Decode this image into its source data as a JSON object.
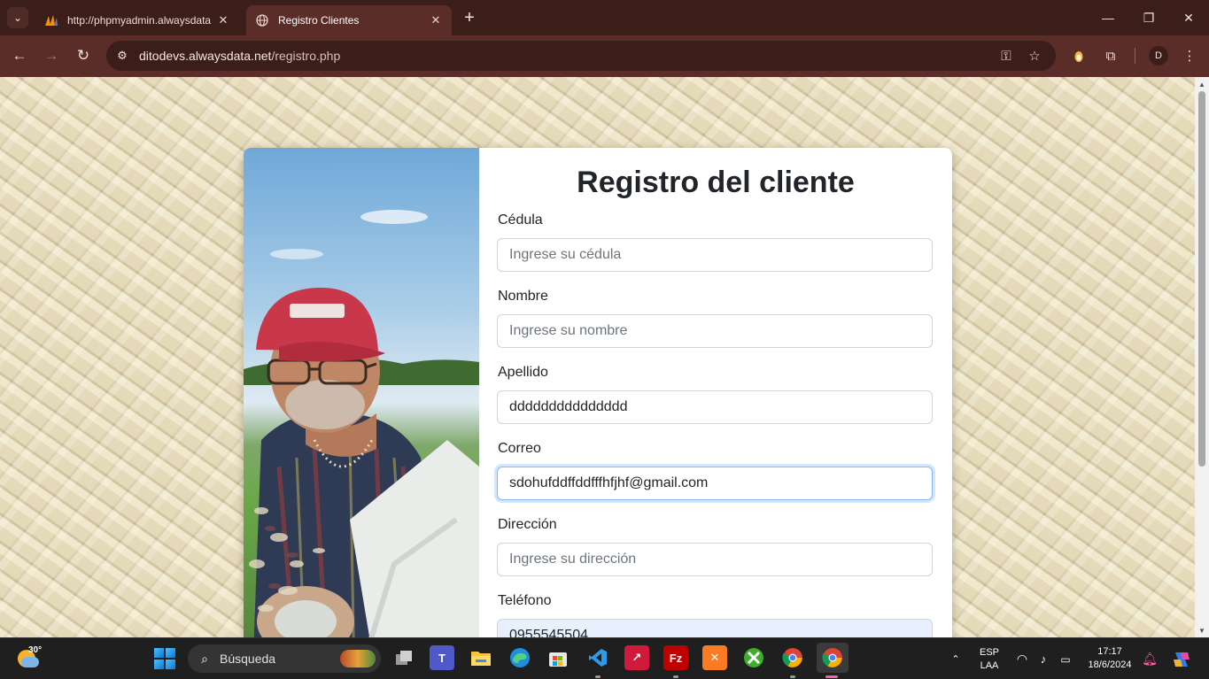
{
  "browser": {
    "tabs": [
      {
        "title": "http://phpmyadmin.alwaysdata",
        "favicon": "phpmyadmin-icon",
        "active": false
      },
      {
        "title": "Registro Clientes",
        "favicon": "globe-icon",
        "active": true
      }
    ],
    "url_host": "ditodevs.alwaysdata.net",
    "url_path": "/registro.php",
    "profile_initial": "D",
    "theme_color": "#5a2d28"
  },
  "form": {
    "title": "Registro del cliente",
    "fields": [
      {
        "label": "Cédula",
        "placeholder": "Ingrese su cédula",
        "value": ""
      },
      {
        "label": "Nombre",
        "placeholder": "Ingrese su nombre",
        "value": ""
      },
      {
        "label": "Apellido",
        "placeholder": "",
        "value": "ddddddddddddddd"
      },
      {
        "label": "Correo",
        "placeholder": "",
        "value": "sdohufddffddfffhfjhf@gmail.com"
      },
      {
        "label": "Dirección",
        "placeholder": "Ingrese su dirección",
        "value": ""
      },
      {
        "label": "Teléfono",
        "placeholder": "",
        "value": "0955545504"
      }
    ],
    "focused_field": "Correo"
  },
  "taskbar": {
    "weather_temp": "30°",
    "search_placeholder": "Búsqueda",
    "apps": [
      "task-view-icon",
      "teams-icon",
      "file-explorer-icon",
      "edge-icon",
      "store-icon",
      "vscode-icon",
      "app-red-icon",
      "filezilla-icon",
      "xampp-icon",
      "xbox-icon",
      "chrome-icon",
      "chrome-profile-icon"
    ],
    "language": "ESP",
    "layout": "LAA",
    "time": "17:17",
    "date": "18/6/2024"
  }
}
